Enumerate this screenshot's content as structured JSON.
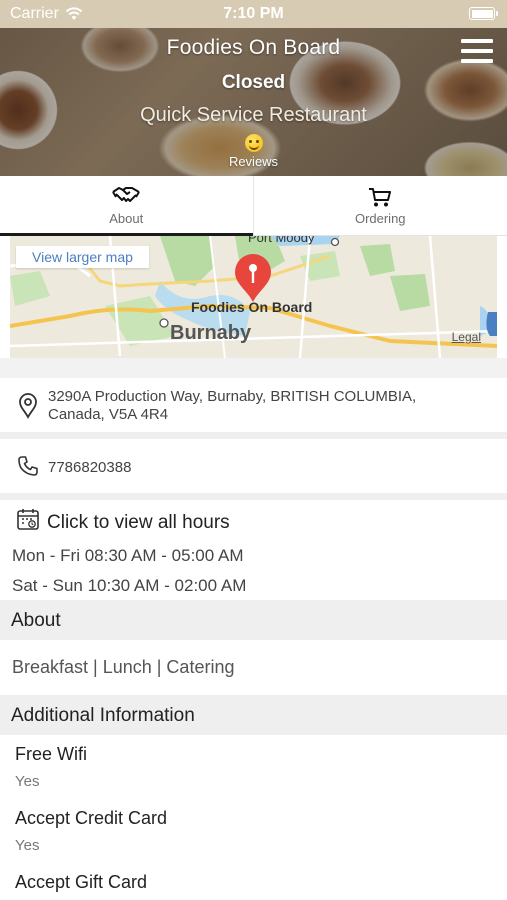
{
  "status_bar": {
    "carrier": "Carrier",
    "time": "7:10 PM"
  },
  "hero": {
    "restaurant_name": "Foodies On Board",
    "status": "Closed",
    "type": "Quick Service Restaurant",
    "reviews_label": "Reviews"
  },
  "tabs": [
    {
      "label": "About",
      "icon": "handshake-icon",
      "active": true
    },
    {
      "label": "Ordering",
      "icon": "cart-icon",
      "active": false
    }
  ],
  "map": {
    "view_larger_label": "View larger map",
    "place_label": "Foodies On Board",
    "city_label": "Burnaby",
    "area_label": "Port Moody",
    "legal_label": "Legal"
  },
  "address": "3290A Production Way, Burnaby, BRITISH COLUMBIA, Canada, V5A 4R4",
  "phone": "7786820388",
  "hours": {
    "title": "Click to view all hours",
    "lines": [
      "Mon - Fri 08:30 AM - 05:00 AM",
      "Sat - Sun 10:30 AM - 02:00 AM"
    ]
  },
  "about": {
    "header": "About",
    "text": "Breakfast | Lunch | Catering"
  },
  "additional_info": {
    "header": "Additional Information",
    "items": [
      {
        "label": "Free Wifi",
        "value": "Yes"
      },
      {
        "label": "Accept Credit Card",
        "value": "Yes"
      },
      {
        "label": "Accept Gift Card",
        "value": ""
      }
    ]
  },
  "colors": {
    "status_bar": "#d8cbb3",
    "link": "#4a7fc1",
    "map_pin": "#e8453c",
    "section_bg": "#efefef"
  }
}
